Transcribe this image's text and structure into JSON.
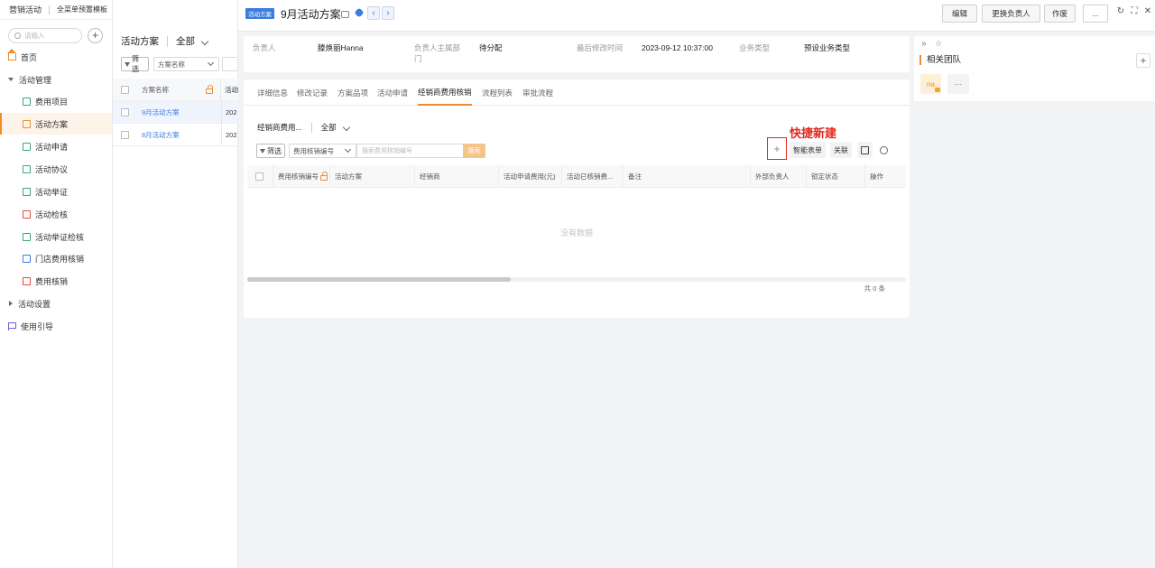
{
  "app": {
    "name": "营销活动",
    "template": "全菜单预置模板",
    "search_placeholder": "请输入"
  },
  "nav": {
    "home": "首页",
    "group_activity": "活动管理",
    "items": [
      "费用项目",
      "活动方案",
      "活动申请",
      "活动协议",
      "活动举证",
      "活动检核",
      "活动举证检核",
      "门店费用核销",
      "费用核销"
    ],
    "group_settings": "活动设置",
    "guide": "使用引导"
  },
  "list": {
    "title": "方案名称_header",
    "object_name": "活动方案",
    "scope": "全部",
    "filter_label": "筛选",
    "field_select": "方案名称",
    "column_header": "方案名称",
    "cut_header": "活动",
    "rows": [
      {
        "name": "9月活动方案",
        "cut": "202"
      },
      {
        "name": "8月活动方案",
        "cut": "202"
      }
    ]
  },
  "detail": {
    "object_tag": "活动方案",
    "title": "9月活动方案",
    "buttons": {
      "edit": "编辑",
      "change_owner": "更换负责人",
      "void": "作废",
      "more": "..."
    }
  },
  "info": {
    "owner_label": "负责人",
    "owner_value": "滕焕丽Hanna",
    "dept_label_1": "负责人主属部",
    "dept_label_2": "门",
    "dept_value": "待分配",
    "modified_label": "最后修改时间",
    "modified_value": "2023-09-12 10:37:00",
    "biz_label": "业务类型",
    "biz_value": "预设业务类型"
  },
  "tabs": [
    "详细信息",
    "修改记录",
    "方案品项",
    "活动申请",
    "经销商费用核销",
    "流程列表",
    "审批流程"
  ],
  "related": {
    "title": "经销商费用...",
    "scope": "全部",
    "filter_label": "筛选",
    "field_select": "费用核销编号",
    "search_placeholder": "搜索费用核销编号",
    "search_button": "搜索",
    "quick_add_label": "快捷新建",
    "smart_table": "智能表单",
    "link": "关联",
    "columns": [
      "费用核销编号",
      "活动方案",
      "经销商",
      "活动申请费用(元)",
      "活动已核销费...",
      "备注",
      "外部负责人",
      "锁定状态",
      "操作"
    ],
    "empty_text": "没有数据",
    "total": "共 0 条"
  },
  "team": {
    "title": "相关团队",
    "member_initials": "na",
    "more": "···"
  }
}
